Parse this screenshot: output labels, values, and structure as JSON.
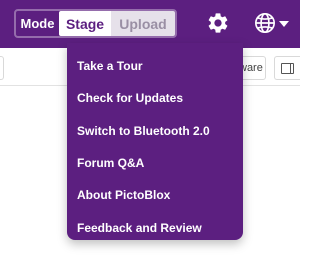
{
  "header": {
    "mode_label": "Mode",
    "stage_label": "Stage",
    "upload_label": "Upload",
    "settings_icon": "gear-icon",
    "language_icon": "globe-icon",
    "language_caret": "caret-down-icon"
  },
  "toolbar": {
    "hardware_label": "ware",
    "layout_icon": "layout-icon"
  },
  "settings_menu": {
    "items": [
      {
        "label": "Take a Tour"
      },
      {
        "label": "Check for Updates"
      },
      {
        "label": "Switch to Bluetooth 2.0"
      },
      {
        "label": "Forum Q&A"
      },
      {
        "label": "About PictoBlox"
      },
      {
        "label": "Feedback and Review"
      }
    ]
  },
  "colors": {
    "brand_purple": "#5c1f80",
    "menu_text": "#ffffff",
    "upload_bg": "#e6e1ea",
    "upload_text": "#9a8fa4"
  }
}
